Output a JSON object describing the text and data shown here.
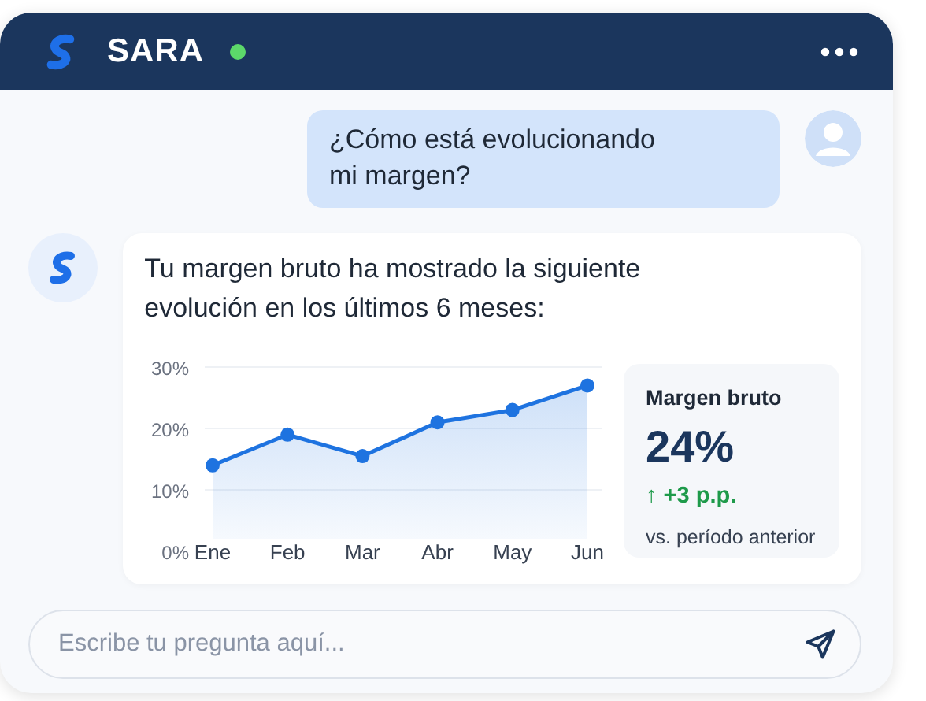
{
  "header": {
    "title": "SARA",
    "online": true
  },
  "messages": [
    {
      "kind": "user",
      "text": "¿Cómo está evolucionando mi margen?"
    },
    {
      "kind": "bot",
      "text": "Tu margen bruto ha mostrado la siguiente evolución en los últimos 6 meses:",
      "chart_data": {
        "type": "area",
        "categories": [
          "Ene",
          "Feb",
          "Mar",
          "Abr",
          "May",
          "Jun"
        ],
        "ylim": [
          0,
          30
        ],
        "yticks": [
          {
            "value": 0,
            "label": "0%"
          },
          {
            "value": 10,
            "label": "10%"
          },
          {
            "value": 20,
            "label": "20%"
          },
          {
            "value": 30,
            "label": "30%"
          }
        ],
        "series": [
          {
            "color": "#1e73e0",
            "values": [
              14,
              19,
              15.5,
              21,
              23,
              27
            ]
          }
        ]
      },
      "stat": {
        "label": "Margen bruto",
        "value": "24%",
        "change": "↑ +3 p.p.",
        "note": "vs. período anterior"
      }
    }
  ],
  "input": {
    "placeholder": "Escribe tu pregunta aquí..."
  }
}
